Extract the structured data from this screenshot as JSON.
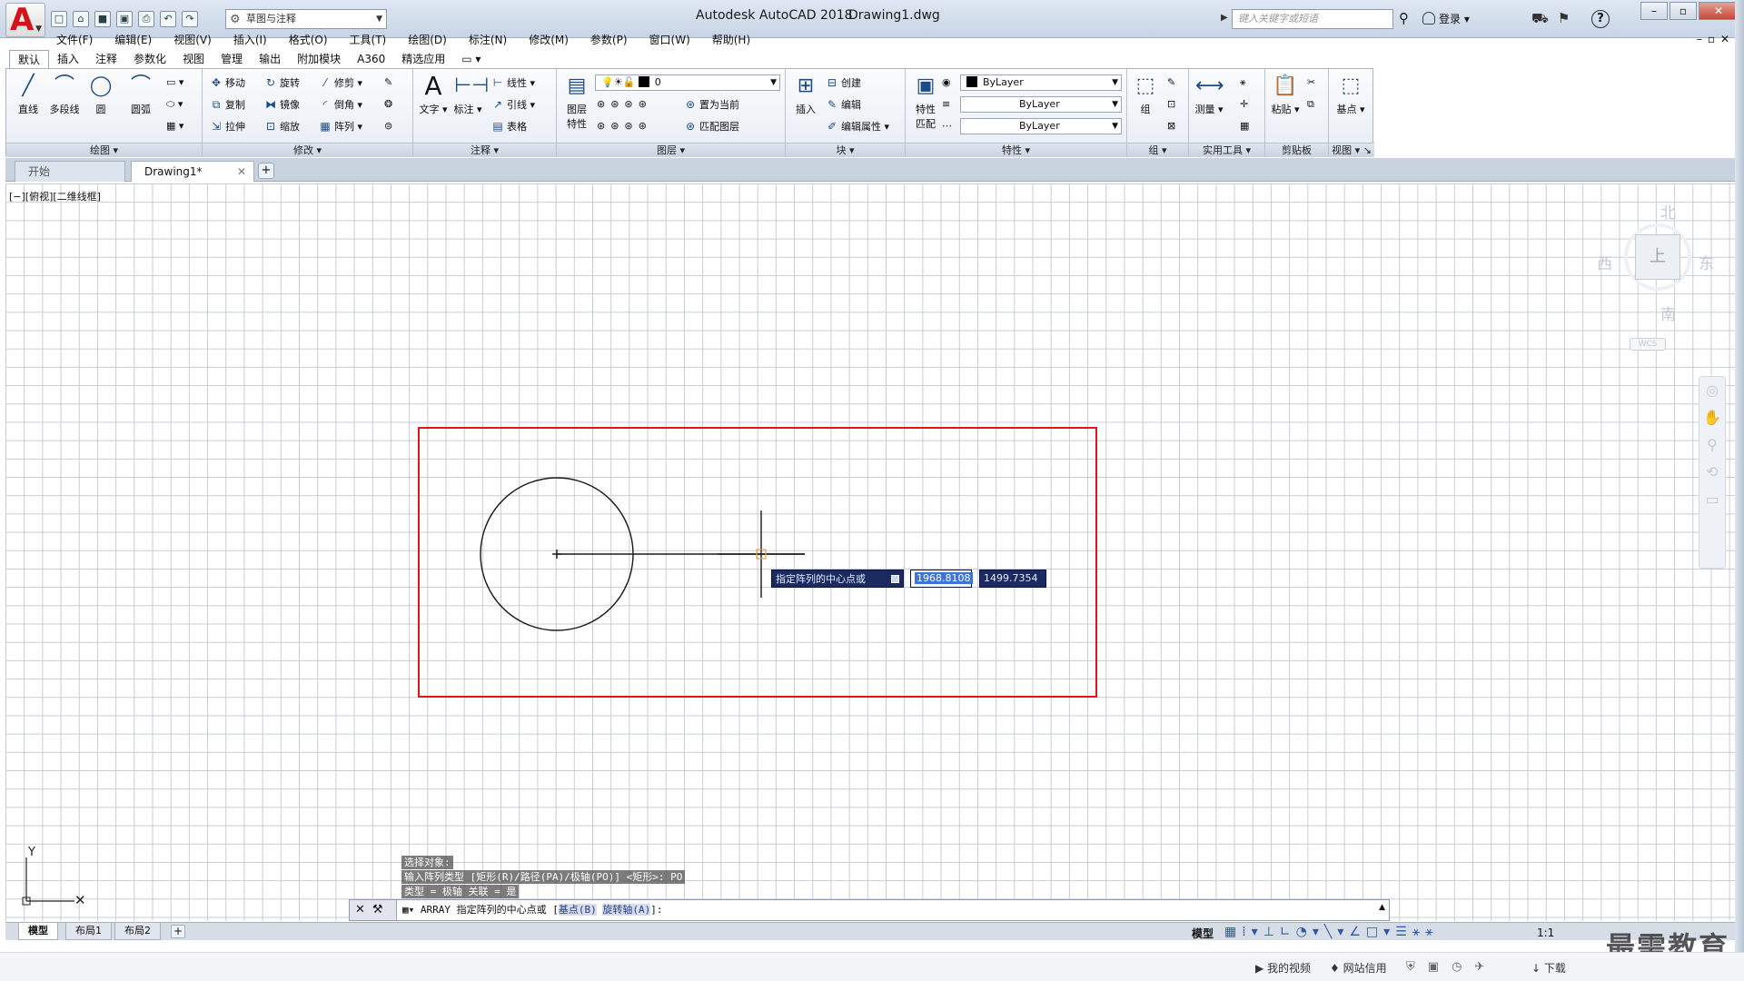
{
  "app": {
    "title": "Autodesk AutoCAD 2018",
    "file": "Drawing1.dwg",
    "logo_letter": "A",
    "workspace": "草图与注释",
    "search_placeholder": "键入关键字或短语",
    "login": "登录"
  },
  "menu": [
    "文件(F)",
    "编辑(E)",
    "视图(V)",
    "插入(I)",
    "格式(O)",
    "工具(T)",
    "绘图(D)",
    "标注(N)",
    "修改(M)",
    "参数(P)",
    "窗口(W)",
    "帮助(H)"
  ],
  "ribbon_tabs": [
    "默认",
    "插入",
    "注释",
    "参数化",
    "视图",
    "管理",
    "输出",
    "附加模块",
    "A360",
    "精选应用"
  ],
  "panels": {
    "draw": {
      "title": "绘图",
      "line": "直线",
      "polyline": "多段线",
      "circle": "圆",
      "arc": "圆弧"
    },
    "modify": {
      "title": "修改",
      "move": "移动",
      "rotate": "旋转",
      "trim": "修剪",
      "copy": "复制",
      "mirror": "镜像",
      "fillet": "倒角",
      "stretch": "拉伸",
      "scale": "缩放",
      "array": "阵列"
    },
    "annotation": {
      "title": "注释",
      "text": "文字",
      "dimension": "标注",
      "linear": "线性",
      "leader": "引线",
      "table": "表格"
    },
    "layers": {
      "title": "图层",
      "props": "图层\n特性",
      "current_layer": "0",
      "set_current": "置为当前",
      "match_layer": "匹配图层"
    },
    "block": {
      "title": "块",
      "insert": "插入",
      "create": "创建",
      "edit": "编辑",
      "edit_attr": "编辑属性"
    },
    "properties": {
      "title": "特性",
      "match": "特性\n匹配",
      "color": "ByLayer",
      "linetype": "ByLayer",
      "lineweight": "ByLayer"
    },
    "groups": {
      "title": "组",
      "group": "组"
    },
    "utilities": {
      "title": "实用工具",
      "measure": "测量"
    },
    "clipboard": {
      "title": "剪贴板",
      "paste": "粘贴"
    },
    "view": {
      "title": "视图",
      "base": "基点"
    }
  },
  "file_tabs": [
    "开始",
    "Drawing1*"
  ],
  "view_label": "[−][俯视][二维线框]",
  "viewcube": {
    "north": "北",
    "south": "南",
    "east": "东",
    "west": "西",
    "wcs": "WCS"
  },
  "dynamic_input": {
    "prompt": "指定阵列的中心点或",
    "x": "1968.8108",
    "y": "1499.7354"
  },
  "command_history": [
    "选择对象:",
    "输入阵列类型 [矩形(R)/路径(PA)/极轴(PO)] <矩形>: PO",
    "类型 = 极轴  关联 = 是"
  ],
  "command_line": {
    "prefix": "ARRAY 指定阵列的中心点或 [",
    "opt1": "基点(B)",
    "opt2": "旋转轴(A)",
    "suffix": "]:"
  },
  "layout_tabs": [
    "模型",
    "布局1",
    "布局2"
  ],
  "status": {
    "model": "模型",
    "scale": "1:1"
  },
  "taskbar": {
    "video": "我的视频",
    "net": "网站信用",
    "download": "下载"
  },
  "watermark": "最需教育",
  "colors": {
    "selection": "#e8131a",
    "tooltip_bg": "#1b2b62"
  }
}
